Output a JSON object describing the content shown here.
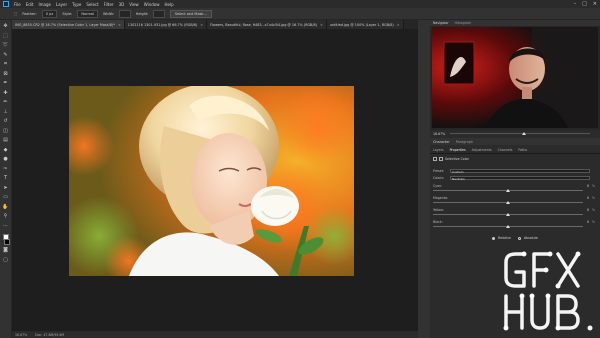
{
  "menubar": {
    "items": [
      "File",
      "Edit",
      "Image",
      "Layer",
      "Type",
      "Select",
      "Filter",
      "3D",
      "View",
      "Window",
      "Help"
    ]
  },
  "optionsbar": {
    "feather_label": "Feather:",
    "feather_value": "0 px",
    "style_label": "Style:",
    "style_value": "Normal",
    "width_label": "Width:",
    "height_label": "Height:",
    "select_mask_label": "Select and Mask..."
  },
  "tabs": [
    {
      "label": "IMG_8855.CR2 @ 16.7% (Selective Color 1, Layer Mask/8)*"
    },
    {
      "label": "1302116 1301-931.jpg @ 66.7% (RGB/8)"
    },
    {
      "label": "Flowers, Beautiful, Rose, 6483...s7u4z3l4.jpg @ 16.7% (RGB/8)"
    },
    {
      "label": "untitled.jpg @ 100% (Layer 1, RGB/8)"
    }
  ],
  "status": {
    "zoom": "16.67%",
    "doc_info": "Doc: 47.8M/95.6M"
  },
  "navigator": {
    "title": "Navigator",
    "tab2": "Histogram",
    "zoom": "16.67%"
  },
  "character": {
    "title": "Character",
    "tab2": "Paragraph"
  },
  "properties_tabs": [
    "Layers",
    "Properties",
    "Adjustments",
    "Channels",
    "Paths"
  ],
  "properties": {
    "title": "Selective Color",
    "preset_label": "Preset:",
    "preset_value": "Custom",
    "colors_label": "Colors:",
    "colors_value": "Neutrals",
    "sliders": [
      {
        "label": "Cyan:",
        "value": "0",
        "level": 0
      },
      {
        "label": "Magenta:",
        "value": "0",
        "level": 0
      },
      {
        "label": "Yellow:",
        "value": "0",
        "level": 0
      },
      {
        "label": "Black:",
        "value": "0",
        "level": 0
      }
    ],
    "unit": "%",
    "relative_label": "Relative",
    "absolute_label": "Absolute"
  },
  "watermark": {
    "line1": "GFX",
    "line2": "HUB"
  },
  "colors": {
    "accent": "#31a8ff",
    "panel": "#2b2b2b",
    "canvas": "#1e1e1e"
  }
}
